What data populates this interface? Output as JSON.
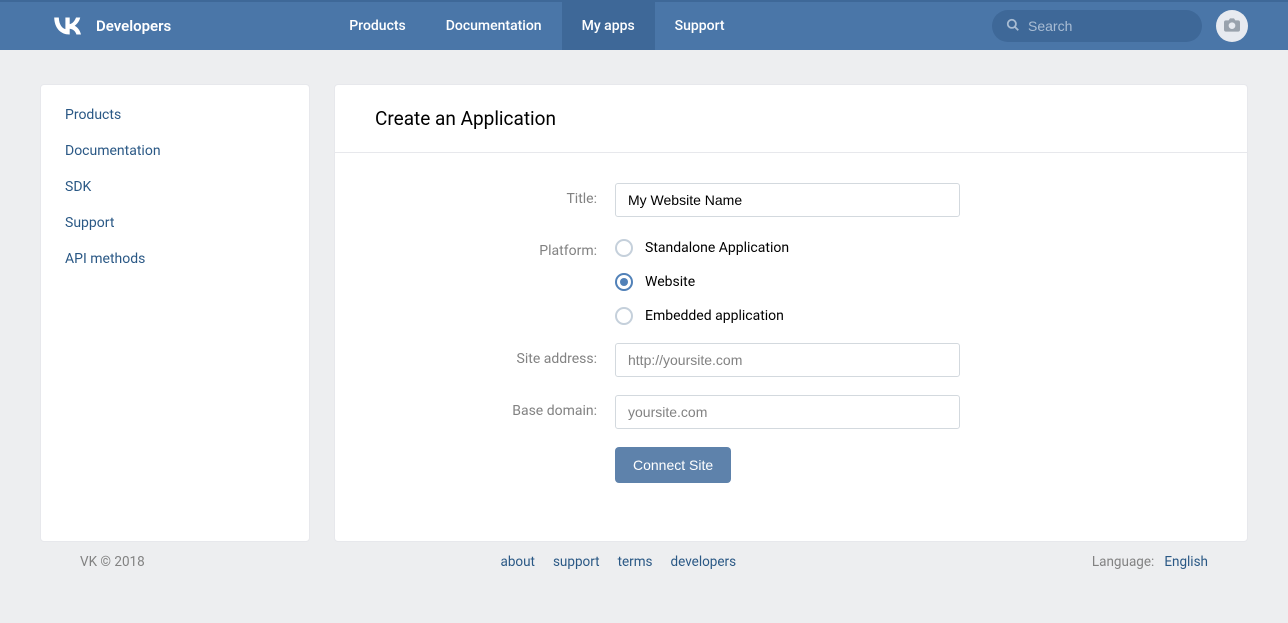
{
  "brand": {
    "name": "Developers"
  },
  "nav": {
    "items": [
      {
        "label": "Products"
      },
      {
        "label": "Documentation"
      },
      {
        "label": "My apps"
      },
      {
        "label": "Support"
      }
    ],
    "active_index": 2
  },
  "search": {
    "placeholder": "Search"
  },
  "sidebar": {
    "items": [
      {
        "label": "Products"
      },
      {
        "label": "Documentation"
      },
      {
        "label": "SDK"
      },
      {
        "label": "Support"
      },
      {
        "label": "API methods"
      }
    ]
  },
  "main": {
    "title": "Create an Application",
    "form": {
      "title_label": "Title:",
      "title_value": "My Website Name",
      "platform_label": "Platform:",
      "platform_options": [
        {
          "label": "Standalone Application"
        },
        {
          "label": "Website"
        },
        {
          "label": "Embedded application"
        }
      ],
      "platform_selected_index": 1,
      "site_address_label": "Site address:",
      "site_address_placeholder": "http://yoursite.com",
      "base_domain_label": "Base domain:",
      "base_domain_placeholder": "yoursite.com",
      "submit_label": "Connect Site"
    }
  },
  "footer": {
    "copyright": "VK © 2018",
    "links": [
      {
        "label": "about"
      },
      {
        "label": "support"
      },
      {
        "label": "terms"
      },
      {
        "label": "developers"
      }
    ],
    "language_label": "Language:",
    "language_value": "English"
  }
}
